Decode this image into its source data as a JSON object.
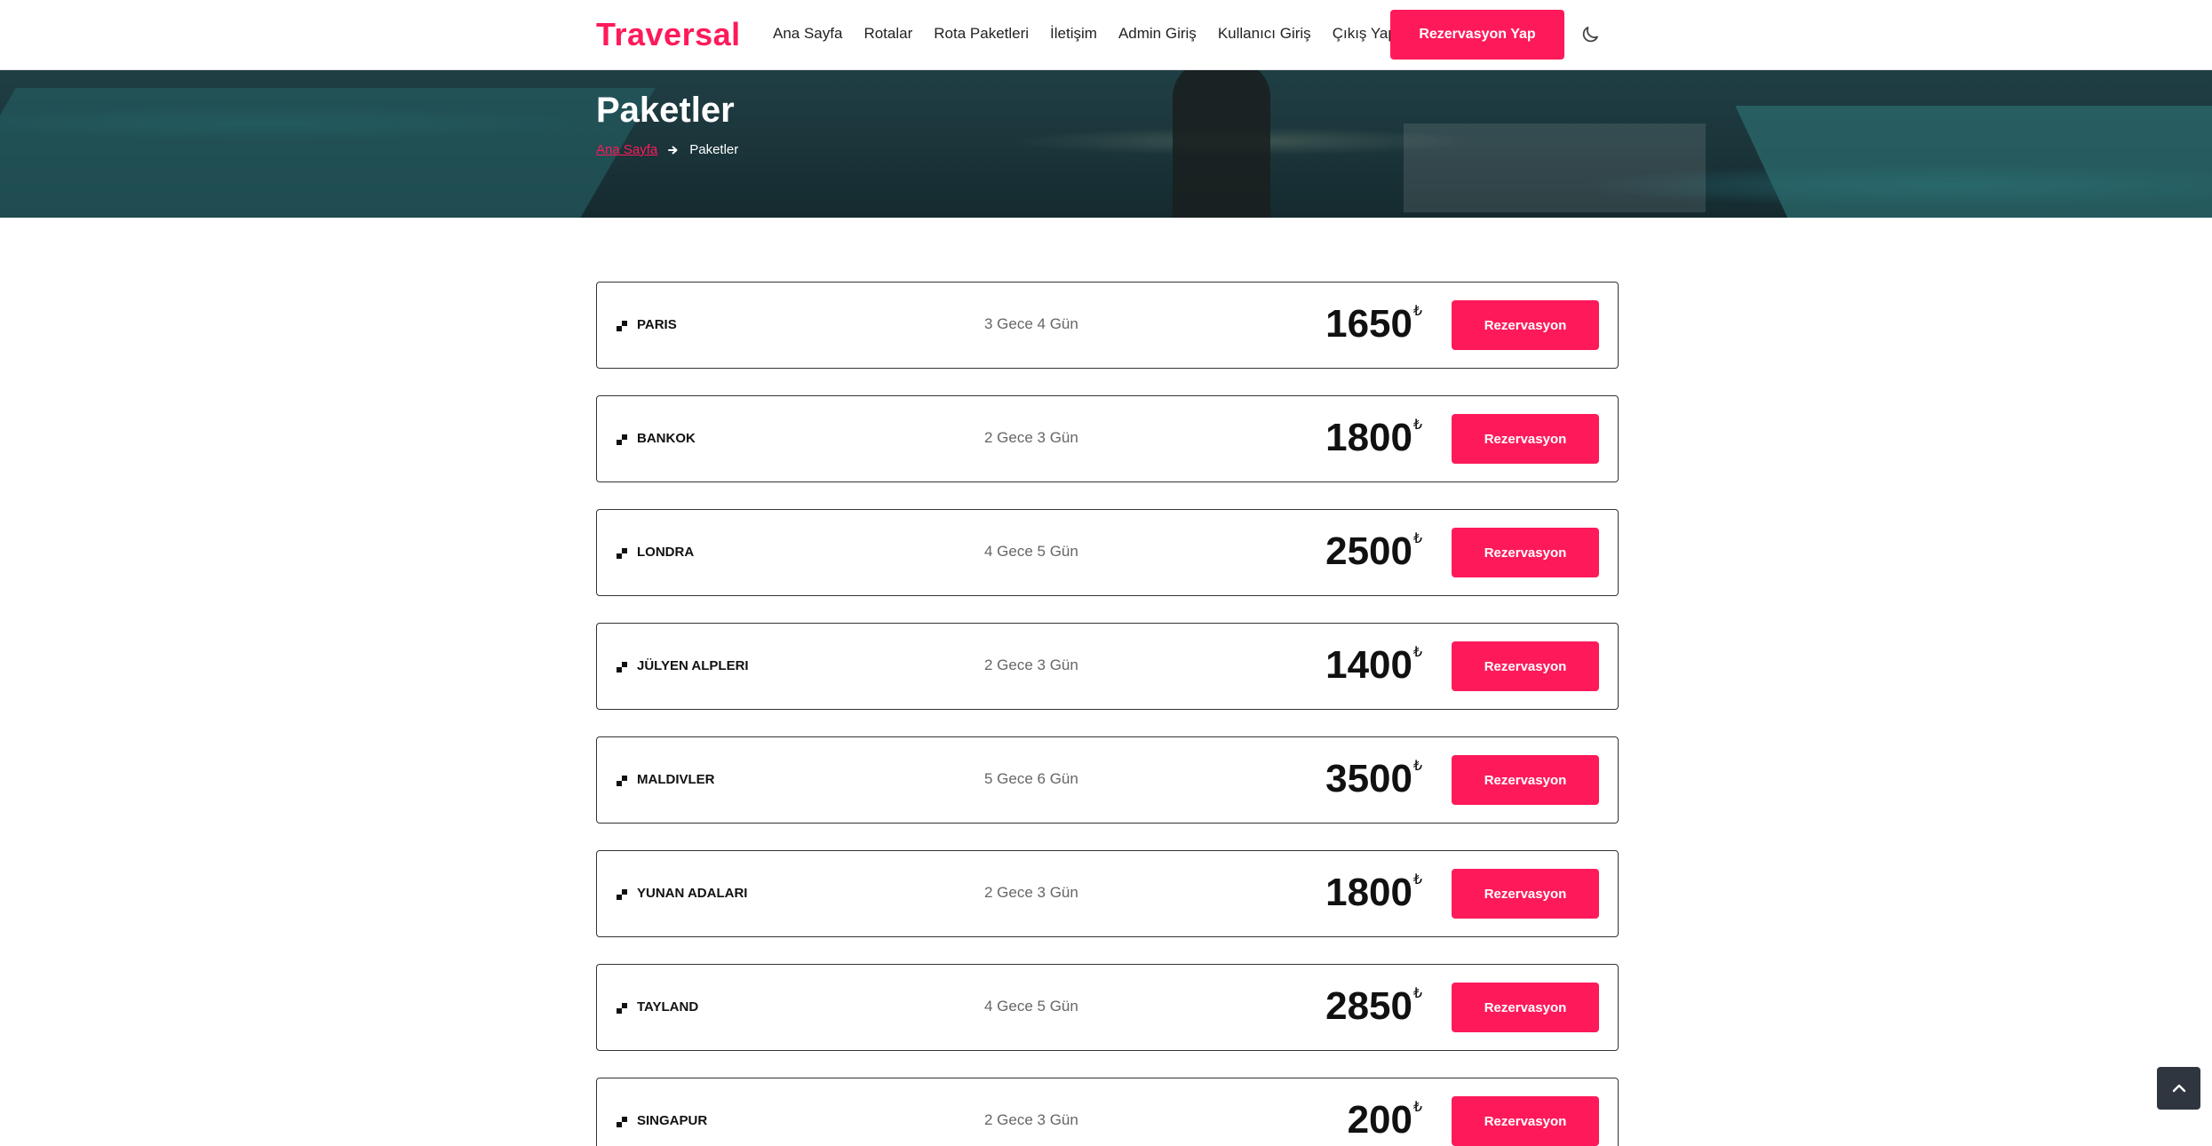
{
  "header": {
    "brand": "Traversal",
    "nav": [
      "Ana Sayfa",
      "Rotalar",
      "Rota Paketleri",
      "İletişim",
      "Admin Giriş",
      "Kullanıcı Giriş",
      "Çıkış Yap"
    ],
    "cta_label": "Rezervasyon Yap",
    "theme_icon": "moon-icon"
  },
  "banner": {
    "title": "Paketler",
    "breadcrumb": {
      "home": "Ana Sayfa",
      "current": "Paketler"
    }
  },
  "packages": [
    {
      "city": "PARIS",
      "duration": "3 Gece 4 Gün",
      "price": "1650",
      "currency": "₺",
      "button": "Rezervasyon"
    },
    {
      "city": "BANKOK",
      "duration": "2 Gece 3 Gün",
      "price": "1800",
      "currency": "₺",
      "button": "Rezervasyon"
    },
    {
      "city": "LONDRA",
      "duration": "4 Gece 5 Gün",
      "price": "2500",
      "currency": "₺",
      "button": "Rezervasyon"
    },
    {
      "city": "JÜLYEN ALPLERI",
      "duration": "2 Gece 3 Gün",
      "price": "1400",
      "currency": "₺",
      "button": "Rezervasyon"
    },
    {
      "city": "MALDIVLER",
      "duration": "5 Gece 6 Gün",
      "price": "3500",
      "currency": "₺",
      "button": "Rezervasyon"
    },
    {
      "city": "YUNAN ADALARI",
      "duration": "2 Gece 3 Gün",
      "price": "1800",
      "currency": "₺",
      "button": "Rezervasyon"
    },
    {
      "city": "TAYLAND",
      "duration": "4 Gece 5 Gün",
      "price": "2850",
      "currency": "₺",
      "button": "Rezervasyon"
    },
    {
      "city": "SINGAPUR",
      "duration": "2 Gece 3 Gün",
      "price": "200",
      "currency": "₺",
      "button": "Rezervasyon"
    }
  ],
  "colors": {
    "accent": "#fe1a5a",
    "scroll_top_bg": "#2f3640"
  },
  "scroll_top_icon": "chevron-up-icon"
}
